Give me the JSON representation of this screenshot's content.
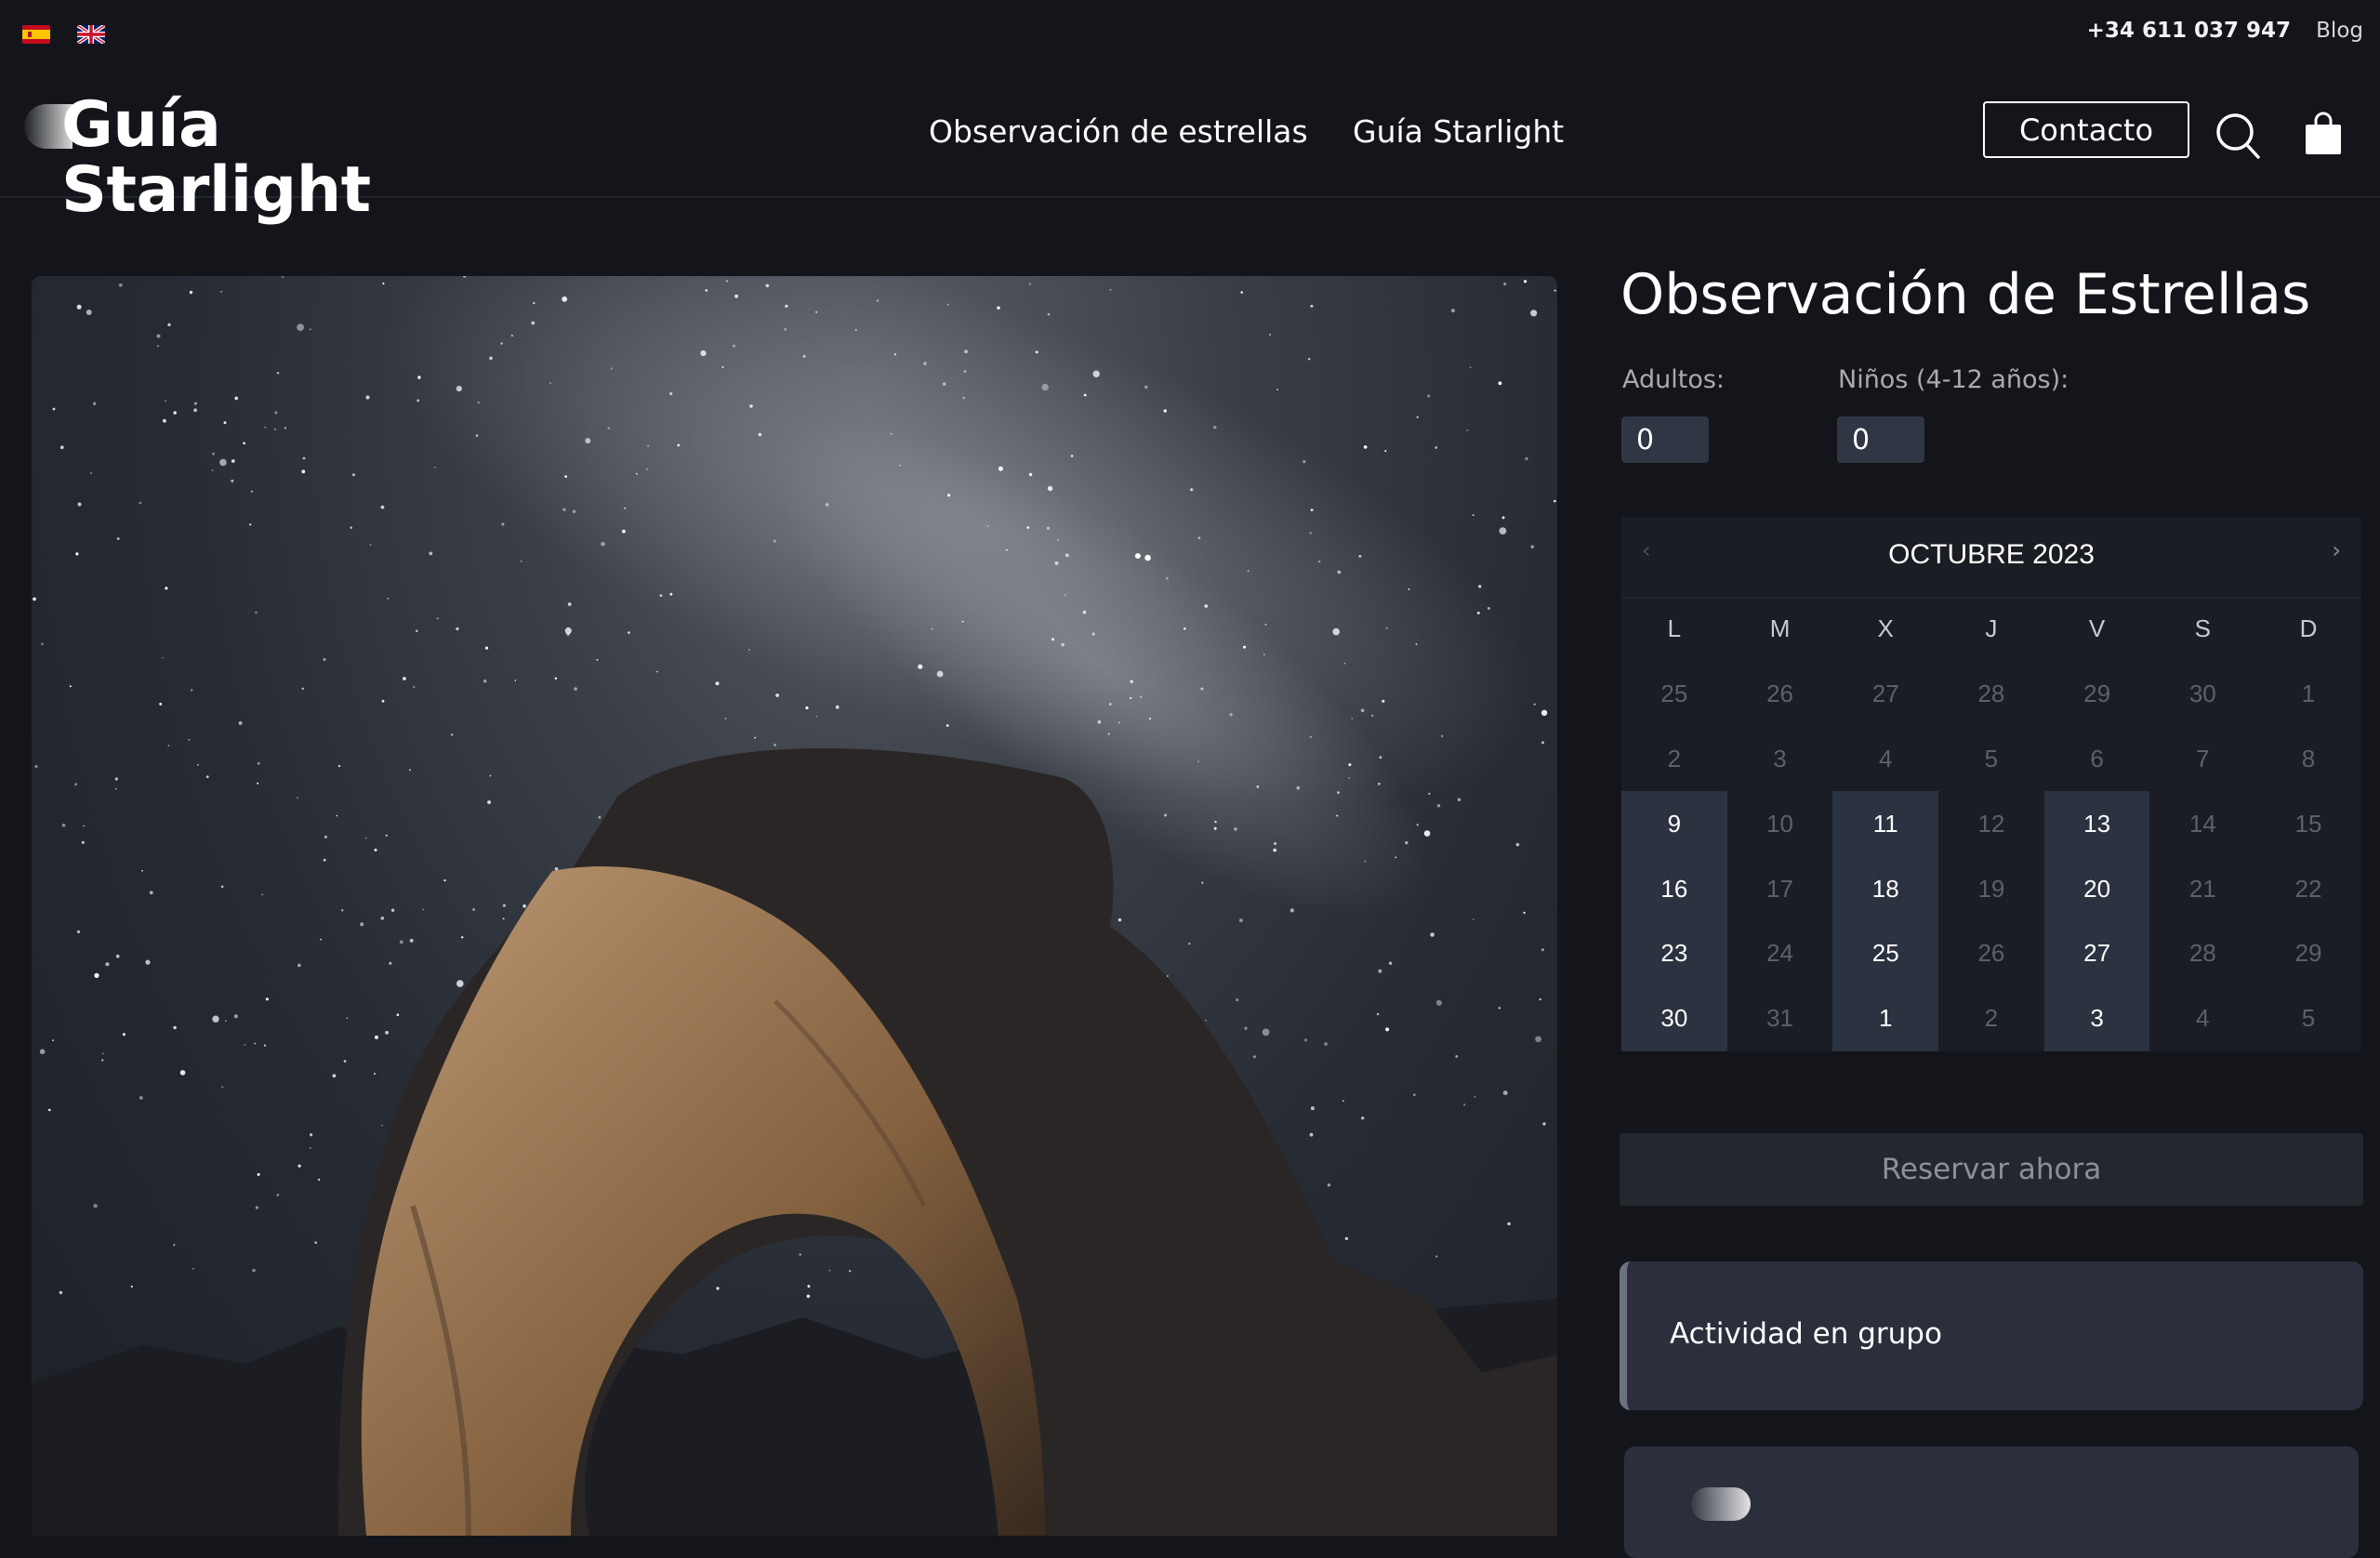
{
  "topbar": {
    "languages": [
      {
        "code": "es",
        "icon": "spain-flag-icon"
      },
      {
        "code": "en",
        "icon": "uk-flag-icon"
      }
    ],
    "phone": "+34 611 037 947",
    "blog": "Blog"
  },
  "header": {
    "logo_text": "Guía Starlight",
    "nav": [
      "Observación de estrellas",
      "Guía Starlight"
    ],
    "contact_label": "Contacto",
    "search_icon": "search-icon",
    "cart_icon": "shopping-bag-icon"
  },
  "product": {
    "title": "Observación de Estrellas",
    "adults_label": "Adultos:",
    "adults_value": "0",
    "children_label": "Niños (4-12 años):",
    "children_value": "0"
  },
  "calendar": {
    "month_label": "OCTUBRE 2023",
    "weekdays": [
      "L",
      "M",
      "X",
      "J",
      "V",
      "S",
      "D"
    ],
    "days": [
      {
        "d": "25",
        "avail": false
      },
      {
        "d": "26",
        "avail": false
      },
      {
        "d": "27",
        "avail": false
      },
      {
        "d": "28",
        "avail": false
      },
      {
        "d": "29",
        "avail": false
      },
      {
        "d": "30",
        "avail": false
      },
      {
        "d": "1",
        "avail": false
      },
      {
        "d": "2",
        "avail": false
      },
      {
        "d": "3",
        "avail": false
      },
      {
        "d": "4",
        "avail": false
      },
      {
        "d": "5",
        "avail": false
      },
      {
        "d": "6",
        "avail": false
      },
      {
        "d": "7",
        "avail": false
      },
      {
        "d": "8",
        "avail": false
      },
      {
        "d": "9",
        "avail": true
      },
      {
        "d": "10",
        "avail": false
      },
      {
        "d": "11",
        "avail": true
      },
      {
        "d": "12",
        "avail": false
      },
      {
        "d": "13",
        "avail": true
      },
      {
        "d": "14",
        "avail": false
      },
      {
        "d": "15",
        "avail": false
      },
      {
        "d": "16",
        "avail": true
      },
      {
        "d": "17",
        "avail": false
      },
      {
        "d": "18",
        "avail": true
      },
      {
        "d": "19",
        "avail": false
      },
      {
        "d": "20",
        "avail": true
      },
      {
        "d": "21",
        "avail": false
      },
      {
        "d": "22",
        "avail": false
      },
      {
        "d": "23",
        "avail": true
      },
      {
        "d": "24",
        "avail": false
      },
      {
        "d": "25",
        "avail": true
      },
      {
        "d": "26",
        "avail": false
      },
      {
        "d": "27",
        "avail": true
      },
      {
        "d": "28",
        "avail": false
      },
      {
        "d": "29",
        "avail": false
      },
      {
        "d": "30",
        "avail": true
      },
      {
        "d": "31",
        "avail": false
      },
      {
        "d": "1",
        "avail": true
      },
      {
        "d": "2",
        "avail": false
      },
      {
        "d": "3",
        "avail": true
      },
      {
        "d": "4",
        "avail": false
      },
      {
        "d": "5",
        "avail": false
      }
    ]
  },
  "reserve_label": "Reservar ahora",
  "activity_label": "Actividad en grupo",
  "colors": {
    "background": "#13151a",
    "available_day": "#2b3240",
    "card": "#2a2f3b",
    "input": "#2f3644"
  }
}
